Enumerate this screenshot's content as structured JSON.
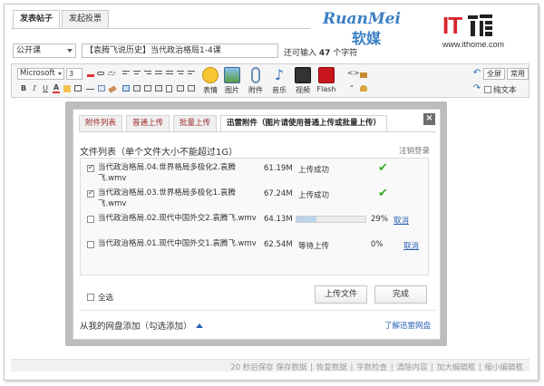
{
  "tabs": [
    {
      "label": "发表帖子",
      "active": true
    },
    {
      "label": "发起投票",
      "active": false
    }
  ],
  "logos": {
    "ruanmei_en": "RuanMei",
    "ruanmei_cn": "软媒",
    "ithome_mark": "IT",
    "ithome_url": "www.ithome.com"
  },
  "post": {
    "category": "公开课",
    "title": "【袁腾飞说历史】当代政治格局1-4课",
    "remaining_prefix": "还可输入",
    "remaining_count": "47",
    "remaining_suffix": "个字符"
  },
  "toolbar": {
    "font_family": "Microsoft",
    "font_size": "3",
    "tools": [
      {
        "icon": "smiley-icon",
        "label": "表情"
      },
      {
        "icon": "image-icon",
        "label": "图片"
      },
      {
        "icon": "attachment-icon",
        "label": "附件"
      },
      {
        "icon": "music-icon",
        "label": "音乐"
      },
      {
        "icon": "video-icon",
        "label": "视频"
      },
      {
        "icon": "flash-icon",
        "label": "Flash"
      }
    ],
    "fullscreen": "全屏",
    "common": "常用",
    "plain_text": "纯文本"
  },
  "dialog": {
    "tabs": [
      {
        "label": "附件列表",
        "active": false
      },
      {
        "label": "普通上传",
        "active": false
      },
      {
        "label": "批量上传",
        "active": false
      },
      {
        "label": "迅雷附件（图片请使用普通上传或批量上传）",
        "active": true
      }
    ],
    "list_title": "文件列表（单个文件大小不能超过1G）",
    "logout": "注销登录",
    "files": [
      {
        "name": "当代政治格局.04.世界格局多极化2.袁腾飞.wmv",
        "size": "61.19M",
        "status": "上传成功",
        "checked": true,
        "done": true
      },
      {
        "name": "当代政治格局.03.世界格局多极化1.袁腾飞.wmv",
        "size": "67.24M",
        "status": "上传成功",
        "checked": true,
        "done": true
      },
      {
        "name": "当代政治格局.02.现代中国外交2.袁腾飞.wmv",
        "size": "64.13M",
        "progress": 29,
        "percent": "29%",
        "cancel": "取消",
        "checked": false,
        "done": false
      },
      {
        "name": "当代政治格局.01.现代中国外交1.袁腾飞.wmv",
        "size": "62.54M",
        "status": "等待上传",
        "percent": "0%",
        "cancel": "取消",
        "checked": false,
        "done": false
      }
    ],
    "select_all": "全选",
    "upload_button": "上传文件",
    "done_button": "完成",
    "cloud_add": "从我的网盘添加（勾选添加）",
    "learn_more": "了解迅雷网盘"
  },
  "statusbar": {
    "items": [
      "20 秒后保存 保存数据",
      "恢复数据",
      "字数检查",
      "清除内容",
      "加大编辑框",
      "缩小编辑框"
    ]
  }
}
